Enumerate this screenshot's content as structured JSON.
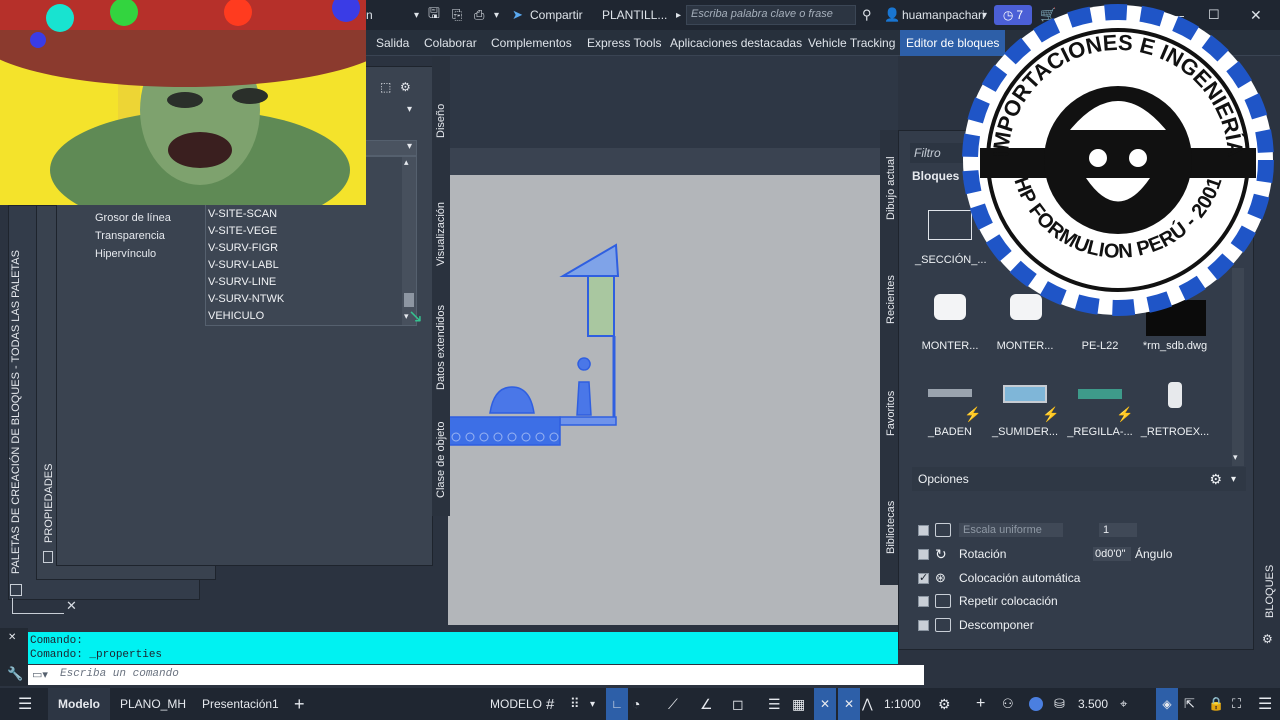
{
  "title_bar": {
    "doc_suffix": "n",
    "share_label": "Compartir",
    "doc_name": "PLANTILL...",
    "search_placeholder": "Escriba palabra clave o frase",
    "user": "huamanpachari",
    "badge_count": "7"
  },
  "ribbon_tabs": [
    "Salida",
    "Colaborar",
    "Complementos",
    "Express Tools",
    "Aplicaciones destacadas",
    "Vehicle Tracking",
    "Editor de bloques"
  ],
  "properties": {
    "rows": [
      "Grosor de línea",
      "Transparencia",
      "Hipervínculo"
    ],
    "layers": [
      "V-SITE-SCAN",
      "V-SITE-VEGE",
      "V-SURV-FIGR",
      "V-SURV-LABL",
      "V-SURV-LINE",
      "V-SURV-NTWK",
      "VEHICULO"
    ],
    "side_tabs": [
      "Diseño",
      "Visualización",
      "Datos extendidos",
      "Clase de objeto"
    ],
    "panel_title": "PROPIEDADES",
    "palettes_title": "PALETAS DE CREACIÓN DE BLOQUES - TODAS LAS PALETAS"
  },
  "blocks": {
    "filter_placeholder": "Filtro",
    "section_label": "Bloques r",
    "side_tabs": [
      "Dibujo actual",
      "Recientes",
      "Favoritos",
      "Bibliotecas"
    ],
    "panel_title": "BLOQUES",
    "items": [
      {
        "label": "_SECCIÓN_..."
      },
      {
        "label": "MONTER..."
      },
      {
        "label": "MONTER..."
      },
      {
        "label": "PE-L22"
      },
      {
        "label": "*rm_sdb.dwg"
      },
      {
        "label": "_BADEN"
      },
      {
        "label": "_SUMIDER..."
      },
      {
        "label": "_REGILLA-..."
      },
      {
        "label": "_RETROEX..."
      }
    ],
    "options": {
      "header": "Opciones",
      "scale_label": "Escala uniforme",
      "scale_value": "1",
      "rotation_label": "Rotación",
      "rotation_value": "0d0'0\"",
      "angle_label": "Ángulo",
      "auto_place_label": "Colocación automática",
      "repeat_label": "Repetir colocación",
      "explode_label": "Descomponer"
    }
  },
  "command": {
    "history": [
      "Comando:",
      "Comando:  _properties"
    ],
    "placeholder": "Escriba un comando"
  },
  "status_bar": {
    "tabs": [
      "Modelo",
      "PLANO_MH",
      "Presentación1"
    ],
    "mode": "MODELO",
    "scale": "1:1000",
    "value": "3.500"
  },
  "logo": {
    "top_text": "IMPORTACIONES E INGENIERÍA",
    "bottom_text": "HP FORMULION PERÚ - 2001"
  },
  "colors": {
    "accent": "#2d5fa8",
    "cmd_bg": "#00f2f2",
    "drawing_blue": "#2f5fe0"
  }
}
